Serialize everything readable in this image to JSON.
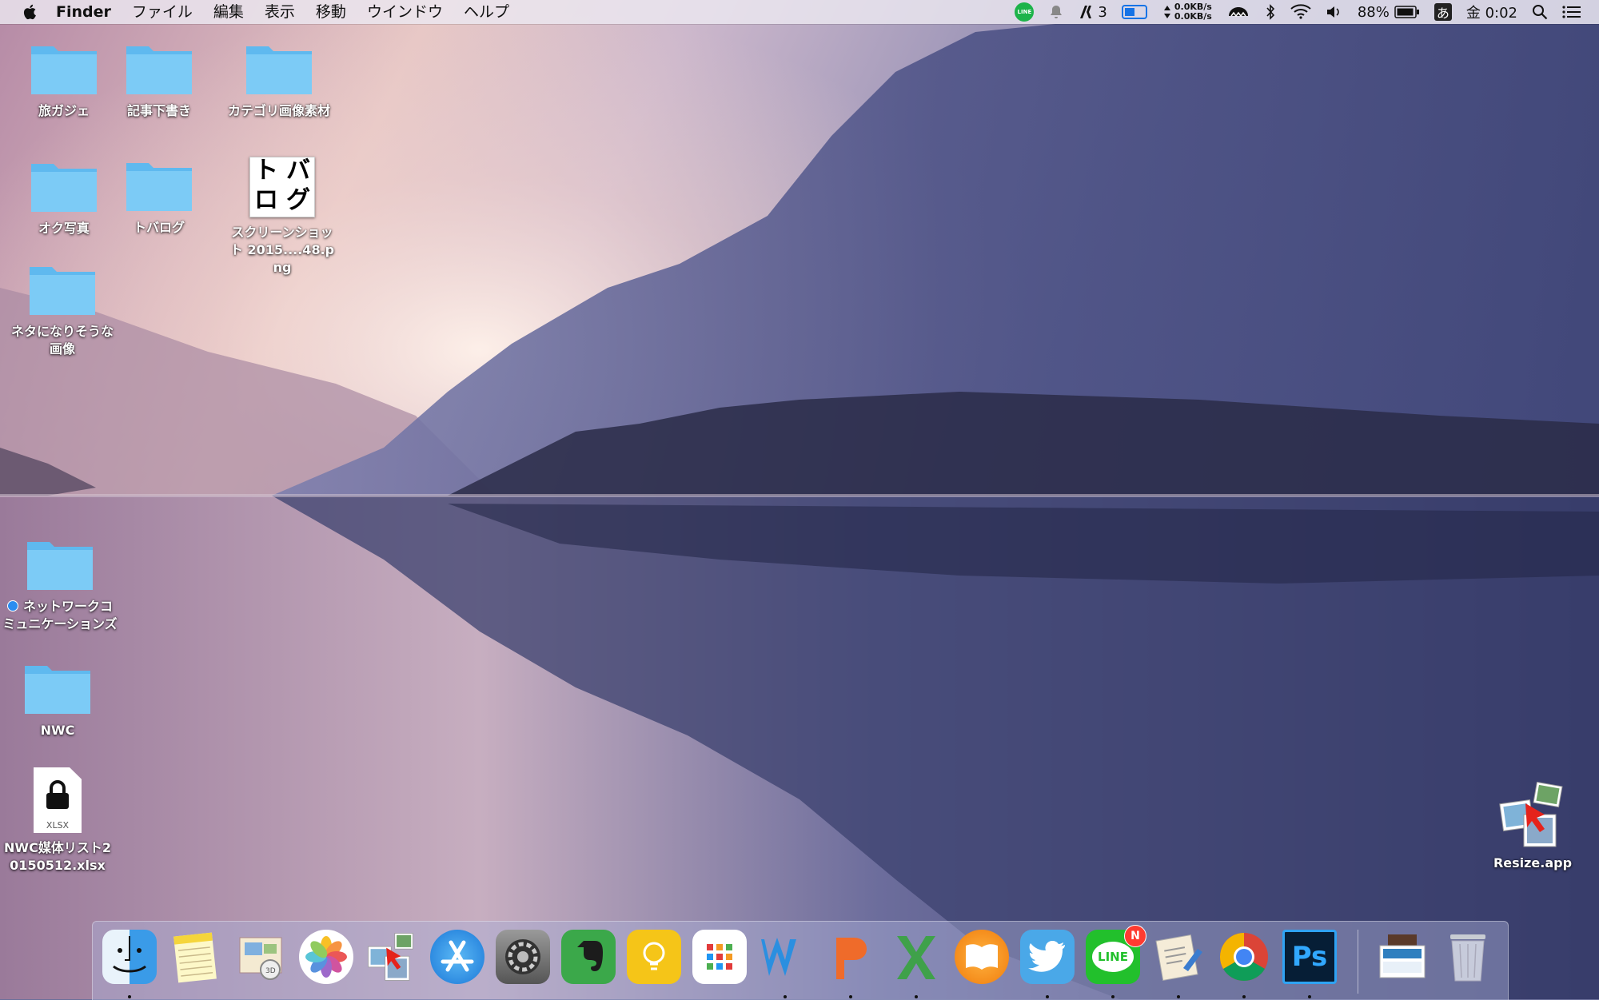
{
  "menubar": {
    "app_name": "Finder",
    "items": [
      "ファイル",
      "編集",
      "表示",
      "移動",
      "ウインドウ",
      "ヘルプ"
    ],
    "status": {
      "line_label": "LINE",
      "adobe_count": "3",
      "net_up": "0.0KB/s",
      "net_down": "0.0KB/s",
      "battery_percent": "88%",
      "ime_label": "あ",
      "clock": "金 0:02"
    }
  },
  "desktop": {
    "items": [
      {
        "name": "旅ガジェ",
        "kind": "folder"
      },
      {
        "name": "記事下書き",
        "kind": "folder"
      },
      {
        "name": "カテゴリ画像素材",
        "kind": "folder"
      },
      {
        "name": "オク写真",
        "kind": "folder"
      },
      {
        "name": "トバログ",
        "kind": "folder"
      },
      {
        "name": "スクリーンショット 2015....48.png",
        "kind": "image",
        "thumb_text": [
          "ト",
          "バ",
          "ロ",
          "グ"
        ]
      },
      {
        "name": "ネタになりそうな画像",
        "kind": "folder"
      },
      {
        "name": "ネットワークコミュニケーションズ",
        "kind": "folder",
        "tag_color": "#2c8df0"
      },
      {
        "name": "NWC",
        "kind": "folder"
      },
      {
        "name": "NWC媒体リスト20150512.xlsx",
        "kind": "locked-file",
        "file_ext": "XLSX"
      },
      {
        "name": "Resize.app",
        "kind": "app"
      }
    ]
  },
  "dock": {
    "apps": [
      {
        "name": "finder-icon",
        "running": true
      },
      {
        "name": "notes-icon",
        "running": false
      },
      {
        "name": "preview-icon",
        "running": false
      },
      {
        "name": "photos-icon",
        "running": false
      },
      {
        "name": "resize-icon",
        "running": false
      },
      {
        "name": "app-store-icon",
        "running": false
      },
      {
        "name": "system-preferences-icon",
        "running": false
      },
      {
        "name": "evernote-icon",
        "running": false
      },
      {
        "name": "idea-bulb-icon",
        "running": false
      },
      {
        "name": "grid-app-icon",
        "running": false
      },
      {
        "name": "word-icon",
        "running": true
      },
      {
        "name": "powerpoint-icon",
        "running": true
      },
      {
        "name": "excel-icon",
        "running": true
      },
      {
        "name": "ibooks-icon",
        "running": false
      },
      {
        "name": "twitter-icon",
        "running": true
      },
      {
        "name": "line-icon",
        "running": true,
        "badge": "N",
        "label": "LINE"
      },
      {
        "name": "scripts-icon",
        "running": true
      },
      {
        "name": "chrome-icon",
        "running": true
      },
      {
        "name": "photoshop-icon",
        "running": true,
        "label": "Ps"
      },
      {
        "name": "documents-stack-icon",
        "running": false
      },
      {
        "name": "trash-icon",
        "running": false
      }
    ]
  }
}
